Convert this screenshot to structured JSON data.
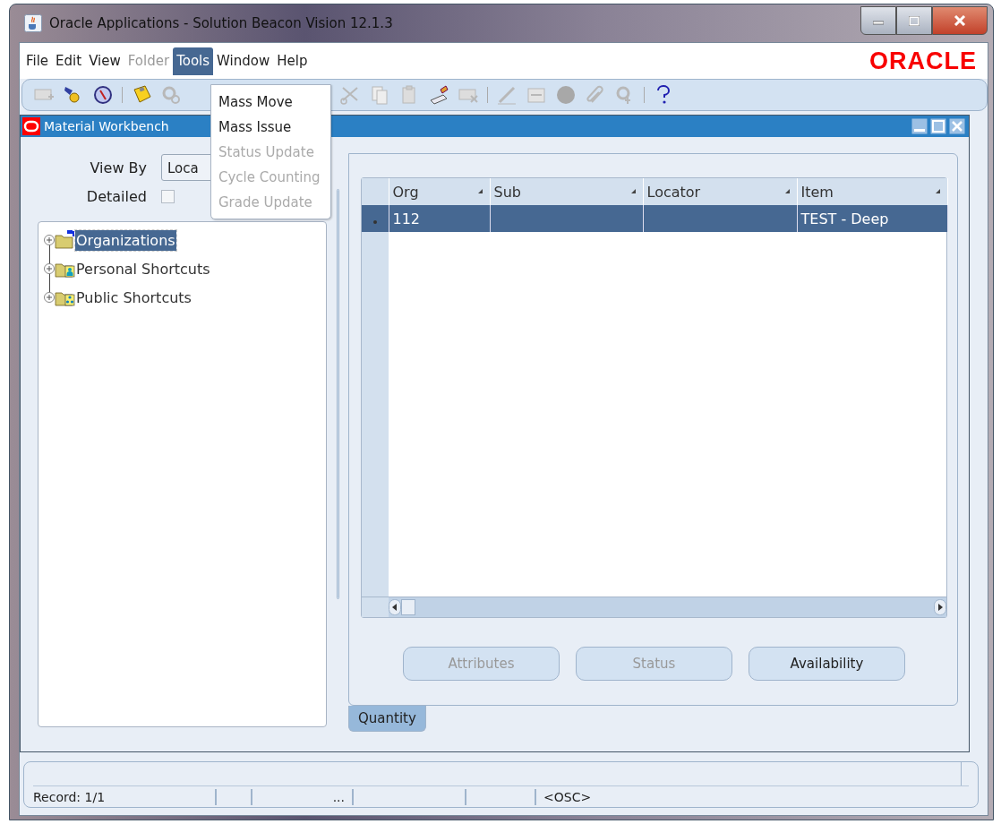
{
  "window": {
    "title": "Oracle Applications - Solution Beacon Vision 12.1.3"
  },
  "menus": [
    {
      "label": "File",
      "disabled": false,
      "selected": false
    },
    {
      "label": "Edit",
      "disabled": false,
      "selected": false
    },
    {
      "label": "View",
      "disabled": false,
      "selected": false
    },
    {
      "label": "Folder",
      "disabled": true,
      "selected": false
    },
    {
      "label": "Tools",
      "disabled": false,
      "selected": true
    },
    {
      "label": "Window",
      "disabled": false,
      "selected": false
    },
    {
      "label": "Help",
      "disabled": false,
      "selected": false
    }
  ],
  "brand": {
    "logo": "ORACLE"
  },
  "open_menu": {
    "items": [
      {
        "label": "Mass Move",
        "disabled": false
      },
      {
        "label": "Mass Issue",
        "disabled": false
      },
      {
        "label": "Status Update",
        "disabled": true
      },
      {
        "label": "Cycle Counting",
        "disabled": true
      },
      {
        "label": "Grade Update",
        "disabled": true
      }
    ]
  },
  "form": {
    "title": "Material Workbench",
    "view_by": {
      "label": "View By",
      "value": "Loca"
    },
    "detailed": {
      "label": "Detailed",
      "checked": false
    },
    "tree": [
      {
        "label": "Organizations",
        "kind": "organizations",
        "expanded": false,
        "selected": true
      },
      {
        "label": "Personal Shortcuts",
        "kind": "personal",
        "expanded": false,
        "selected": false
      },
      {
        "label": "Public Shortcuts",
        "kind": "public",
        "expanded": false,
        "selected": false
      }
    ],
    "table": {
      "columns": [
        "Org",
        "Sub",
        "Locator",
        "Item"
      ],
      "rows": [
        {
          "cells": [
            "112",
            null,
            null,
            "TEST - Deep"
          ],
          "selected": true
        }
      ]
    },
    "buttons": [
      {
        "label": "Attributes",
        "disabled": true
      },
      {
        "label": "Status",
        "disabled": true
      },
      {
        "label": "Availability",
        "disabled": false
      }
    ],
    "tabs": [
      {
        "label": "Quantity",
        "selected": true
      }
    ]
  },
  "status_bar": {
    "record": "Record: 1/1",
    "ellipsis": "...",
    "mode": "<OSC>"
  }
}
